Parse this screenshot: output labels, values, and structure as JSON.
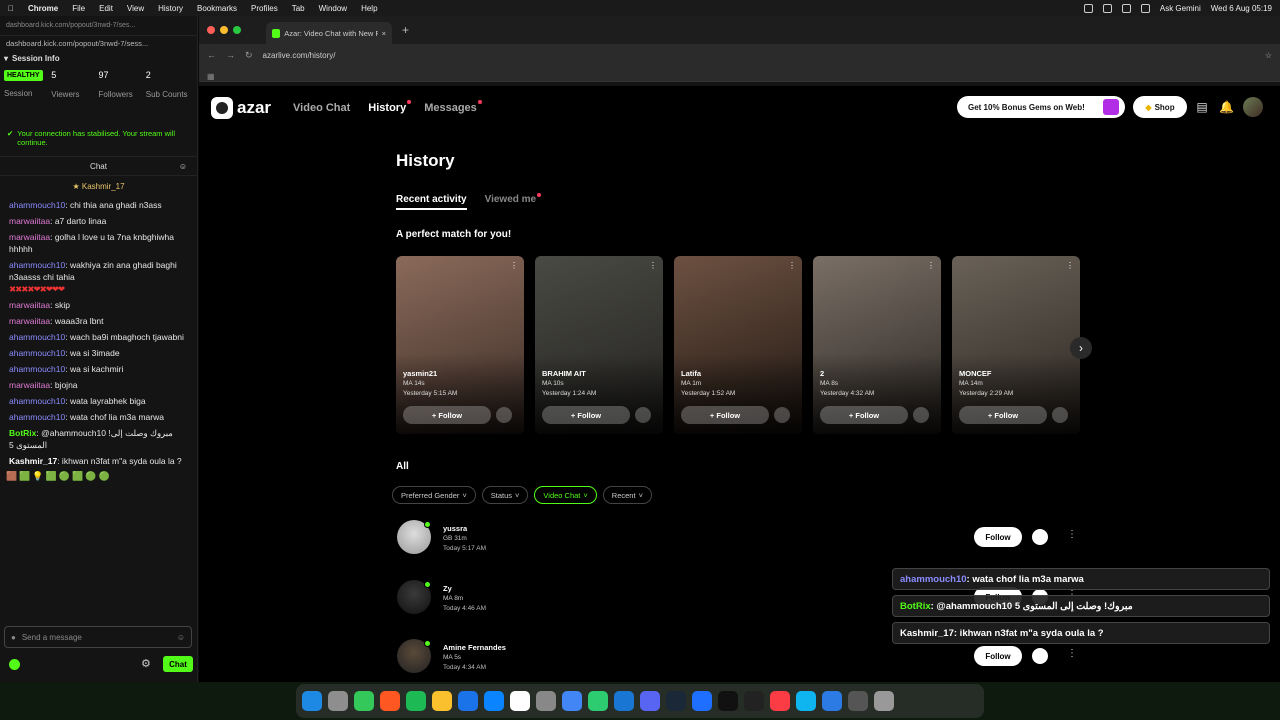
{
  "menubar": {
    "app": "Chrome",
    "items": [
      "File",
      "Edit",
      "View",
      "History",
      "Bookmarks",
      "Profiles",
      "Tab",
      "Window",
      "Help"
    ],
    "ask": "Ask Gemini",
    "clock": "Wed 6 Aug 05:19"
  },
  "left": {
    "url_top": "dashboard.kick.com/popout/3nwd-7/ses...",
    "url": "dashboard.kick.com/popout/3nwd-7/sess...",
    "session_title": "Session Info",
    "healthy": "HEALTHY",
    "stats": [
      {
        "value": "",
        "label": "Session"
      },
      {
        "value": "5",
        "label": "Viewers"
      },
      {
        "value": "97",
        "label": "Followers"
      },
      {
        "value": "2",
        "label": "Sub Counts"
      }
    ],
    "notice": "Your connection has stabilised. Your stream will continue.",
    "chat_header": "Chat",
    "pinned": "Kashmir_17",
    "messages": [
      {
        "user": "ahammouch10",
        "cls": "u-a",
        "text": ": chi thia ana ghadi n3ass"
      },
      {
        "user": "marwaiitaa",
        "cls": "u-m",
        "text": ": a7 darto linaa"
      },
      {
        "user": "marwaiitaa",
        "cls": "u-m",
        "text": ": golha l love u ta 7na knbghiwha hhhhh"
      },
      {
        "user": "ahammouch10",
        "cls": "u-a",
        "text": ": wakhiya zin ana ghadi baghi n3aasss chi tahia"
      },
      {
        "user": "marwaiitaa",
        "cls": "u-m",
        "text": ": skip"
      },
      {
        "user": "marwaiitaa",
        "cls": "u-m",
        "text": ": waaa3ra lbnt"
      },
      {
        "user": "ahammouch10",
        "cls": "u-a",
        "text": ": wach ba9i mbaghoch tjawabni"
      },
      {
        "user": "ahammouch10",
        "cls": "u-a",
        "text": ": wa si 3imade"
      },
      {
        "user": "ahammouch10",
        "cls": "u-a",
        "text": ": wa si kachmiri"
      },
      {
        "user": "marwaiitaa",
        "cls": "u-m",
        "text": ": bjojna"
      },
      {
        "user": "ahammouch10",
        "cls": "u-a",
        "text": ": wata layrabhek biga"
      },
      {
        "user": "ahammouch10",
        "cls": "u-a",
        "text": ": wata chof lia m3a marwa"
      },
      {
        "user": "BotRix",
        "cls": "u-b",
        "text": ": @ahammouch10 !مبروك وصلت إلى المستوى 5"
      },
      {
        "user": "Kashmir_17",
        "cls": "u-k",
        "text": ": ikhwan n3fat m\"a syda oula la ?"
      }
    ],
    "send_placeholder": "Send a message",
    "chat_button": "Chat"
  },
  "browser": {
    "tab_title": "Azar: Video Chat with New P...",
    "address": "azarlive.com/history/"
  },
  "azar": {
    "logo": "azar",
    "nav": [
      "Video Chat",
      "History",
      "Messages"
    ],
    "bonus": "Get 10% Bonus Gems on Web!",
    "shop": "Shop",
    "title": "History",
    "subtabs": [
      "Recent activity",
      "Viewed me"
    ],
    "match_title": "A perfect match for you!",
    "cards": [
      {
        "name": "yasmin21",
        "meta": "MA  14s",
        "time": "Yesterday 5:15 AM",
        "colors": [
          "#8a6a5a",
          "#3b2c26"
        ]
      },
      {
        "name": "BRAHIM AIT",
        "meta": "MA  10s",
        "time": "Yesterday 1:24 AM",
        "colors": [
          "#4a4a44",
          "#22211f"
        ]
      },
      {
        "name": "Latifa",
        "meta": "MA  1m",
        "time": "Yesterday 1:52 AM",
        "colors": [
          "#6d5141",
          "#1f1712"
        ]
      },
      {
        "name": "2",
        "meta": "MA  8s",
        "time": "Yesterday 4:32 AM",
        "colors": [
          "#7a6f66",
          "#2a2622"
        ]
      },
      {
        "name": "MONCEF",
        "meta": "MA  14m",
        "time": "Yesterday 2:29 AM",
        "colors": [
          "#6a6258",
          "#2b2520"
        ]
      }
    ],
    "follow": "Follow",
    "all_title": "All",
    "filters": [
      "Preferred Gender",
      "Status",
      "Video Chat",
      "Recent"
    ],
    "rows": [
      {
        "name": "yussra",
        "meta": "GB  31m",
        "time": "Today 5:17 AM"
      },
      {
        "name": "Zy",
        "meta": "MA  8m",
        "time": "Today 4:46 AM"
      },
      {
        "name": "Amine Fernandes",
        "meta": "MA  5s",
        "time": "Today 4:34 AM"
      }
    ],
    "overlay": [
      {
        "user": "ahammouch10",
        "text": " : wata chof lia m3a marwa"
      },
      {
        "user": "BotRix",
        "text": ": @ahammouch10 5 مبروك! وصلت إلى المستوى"
      },
      {
        "user": "Kashmir_17",
        "text": " : ikhwan n3fat m\"a syda oula la ?"
      }
    ]
  }
}
